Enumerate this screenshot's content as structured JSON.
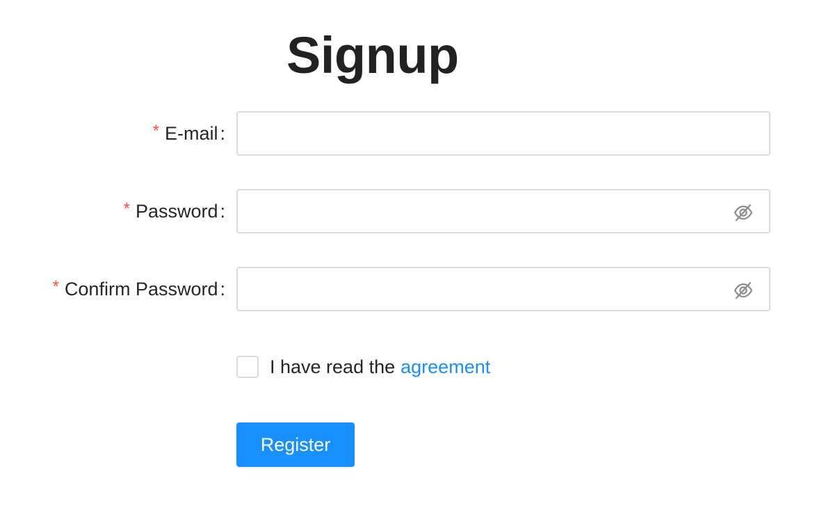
{
  "page": {
    "title": "Signup"
  },
  "form": {
    "email": {
      "label": "E-mail",
      "required_mark": "*",
      "colon": ":",
      "value": "",
      "placeholder": ""
    },
    "password": {
      "label": "Password",
      "required_mark": "*",
      "colon": ":",
      "value": "",
      "placeholder": "",
      "toggle_icon": "eye-invisible-icon"
    },
    "confirm_password": {
      "label": "Confirm Password",
      "required_mark": "*",
      "colon": ":",
      "value": "",
      "placeholder": "",
      "toggle_icon": "eye-invisible-icon"
    },
    "agreement": {
      "checked": false,
      "text": "I have read the",
      "link_text": "agreement"
    },
    "submit_label": "Register"
  },
  "colors": {
    "primary": "#1890ff",
    "required": "#ff4d4f",
    "border": "#d9d9d9",
    "title": "#222222"
  }
}
